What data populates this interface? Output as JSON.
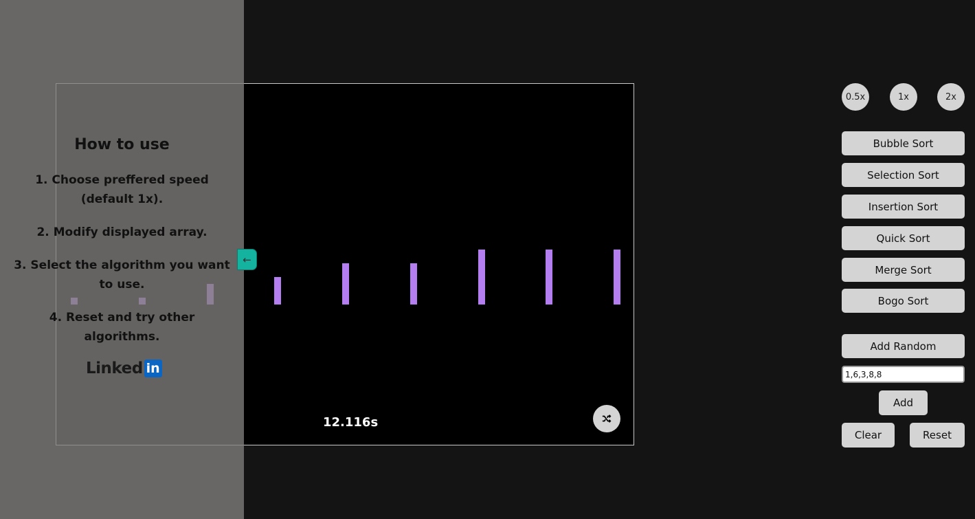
{
  "howto": {
    "title": "How to use",
    "steps": [
      "1. Choose preffered speed (default 1x).",
      "2. Modify displayed array.",
      "3. Select the algorithm you want to use.",
      "4. Reset and try other algorithms."
    ],
    "linkedin_text": "Linked",
    "linkedin_badge": "in",
    "toggle_icon": "←"
  },
  "visualizer": {
    "timer": "12.116s",
    "bar_values": [
      1,
      1,
      3,
      4,
      6,
      6,
      8,
      8,
      8
    ],
    "max_value": 8,
    "bar_color": "#b57ef0"
  },
  "speed": [
    "0.5x",
    "1x",
    "2x"
  ],
  "algorithms": [
    "Bubble Sort",
    "Selection Sort",
    "Insertion Sort",
    "Quick Sort",
    "Merge Sort",
    "Bogo Sort"
  ],
  "controls": {
    "add_random": "Add Random",
    "input_value": "1,6,3,8,8",
    "add": "Add",
    "clear": "Clear",
    "reset": "Reset"
  }
}
